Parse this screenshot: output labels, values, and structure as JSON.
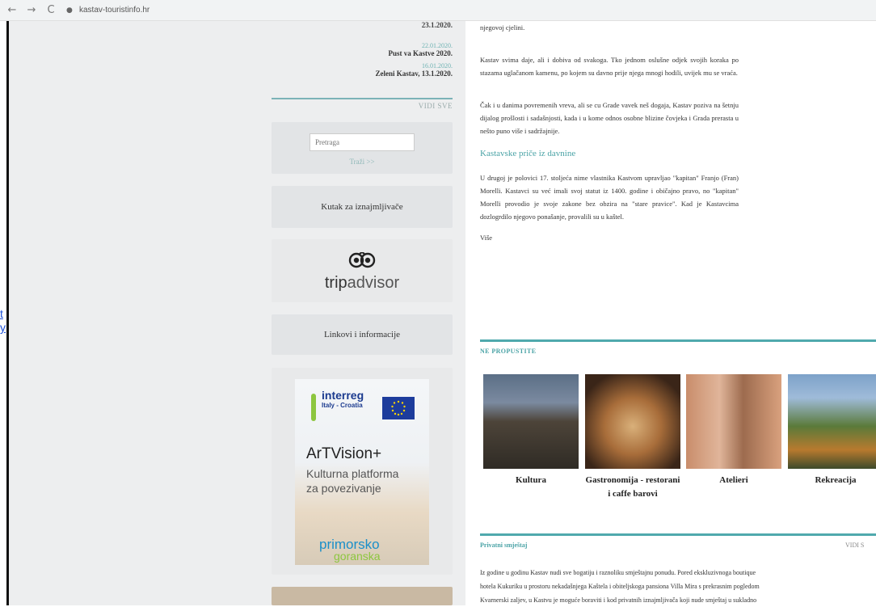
{
  "browser": {
    "back_icon": "←",
    "forward_icon": "→",
    "reload_icon": "C",
    "url": "kastav-touristinfo.hr"
  },
  "edge_link": "t\ny",
  "news": {
    "first_date": "23.1.2020.",
    "items": [
      {
        "date": "22.01.2020.",
        "title": "Pust va Kastve 2020."
      },
      {
        "date": "16.01.2020.",
        "title": "Zeleni Kastav, 13.1.2020."
      }
    ],
    "view_all": "VIDI SVE"
  },
  "search": {
    "placeholder": "Pretraga",
    "button": "Traži >>"
  },
  "sidebar": {
    "corner_label": "Kutak za iznajmljivače",
    "tripadvisor_trip": "trip",
    "tripadvisor_advisor": "advisor",
    "links_label": "Linkovi i informacije"
  },
  "banner": {
    "interreg": "interreg",
    "interreg_sub": "Italy - Croatia",
    "title": "ArTVision+",
    "subtitle_line1": "Kulturna platforma",
    "subtitle_line2": "za povezivanje",
    "logo_top": "primorsko",
    "logo_bottom": "goranska"
  },
  "article": {
    "p1": "njegovoj cjelini.",
    "p2": "Kastav svima daje, ali i dobiva od svakoga. Tko jednom oslušne odjek svojih koraka po stazama uglačanom kamenu, po kojem su davno prije njega mnogi hodili, uvijek mu se vraća.",
    "p3": "Čak i u danima povremenih vreva, ali se cu Grade vavek neš dogaja, Kastav poziva na šetnju dijalog prošlosti i sadašnjosti, kada i u kome odnos osobne blizine čovjeka i Grada prerasta u nešto puno više i sadržajnije.",
    "heading": "Kastavske priče iz davnine",
    "p4": "U drugoj je polovici 17. stoljeća nime vlastnika Kastvom upravljao \"kapitan\" Franjo (Fran) Morelli. Kastavci su već imali svoj statut iz 1400. godine i običajno pravo, no \"kapitan\" Morelli provodio je svoje zakone bez obzira na \"stare pravice\". Kad je Kastavcima dozlogrdilo njegovo ponašanje, provalili su u kaštel.",
    "p5": "Više"
  },
  "miss": {
    "label": "NE PROPUSTITE",
    "cards": [
      {
        "label": "Kultura"
      },
      {
        "label": "Gastronomija - restorani i caffe barovi"
      },
      {
        "label": "Atelieri"
      },
      {
        "label": "Rekreacija"
      }
    ]
  },
  "private": {
    "label": "Privatni smještaj",
    "view_all": "VIDI S",
    "line1": "Iz godine u godinu Kastav nudi sve bogatiju i raznoliku smještajnu ponudu. Pored ekskluzivnoga boutique",
    "line2": "hotela Kukuriku u prostoru nekadašnjega Kaštela i obiteljskoga pansiona Villa Mira s prekrasnim pogledom",
    "line3": "Kvarnerski zaljev, u Kastvu je moguće boraviti i kod privatnih iznajmljivača koji nude smještaj u sukladno"
  },
  "colors": {
    "accent": "#4fa9ad",
    "panel": "#edeeef",
    "box": "#e2e4e6"
  }
}
